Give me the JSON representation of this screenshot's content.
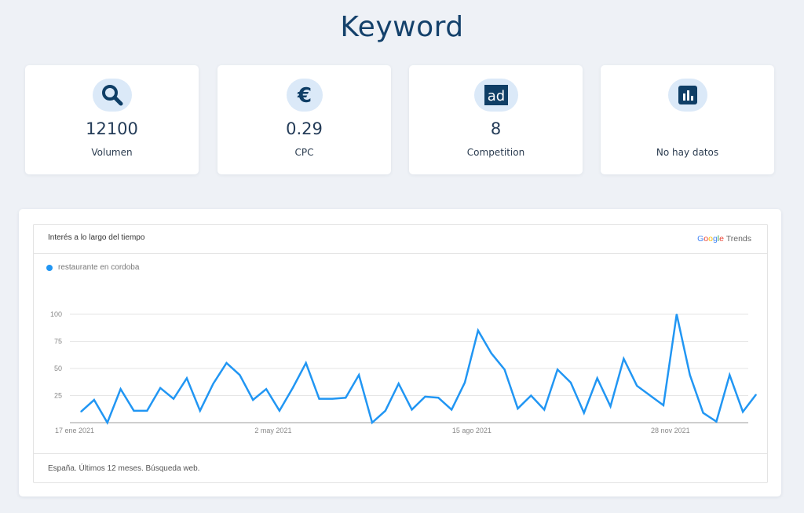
{
  "page": {
    "title": "Keyword"
  },
  "cards": [
    {
      "icon": "search-icon",
      "value": "12100",
      "label": "Volumen"
    },
    {
      "icon": "euro-icon",
      "value": "0.29",
      "label": "CPC"
    },
    {
      "icon": "ad-icon",
      "value": "8",
      "label": "Competition"
    },
    {
      "icon": "bar-chart-icon",
      "value": "",
      "label": "No hay datos"
    }
  ],
  "colors": {
    "accent": "#14416b",
    "icon_bg": "#dbe9f8",
    "line": "#2196f3"
  },
  "trends": {
    "title": "Interés a lo largo del tiempo",
    "logo_google": "Google",
    "logo_trends": "Trends",
    "legend": "restaurante en cordoba",
    "footer": "España. Últimos 12 meses. Búsqueda web."
  },
  "chart_data": {
    "type": "line",
    "ylim": [
      0,
      100
    ],
    "yticks": [
      25,
      50,
      75,
      100
    ],
    "grid": true,
    "x_tick_labels": [
      "17 ene 2021",
      "2 may 2021",
      "15 ago 2021",
      "28 nov 2021"
    ],
    "x_tick_indices": [
      0,
      15,
      30,
      45
    ],
    "series": [
      {
        "name": "restaurante en cordoba",
        "values": [
          10,
          21,
          0,
          31,
          11,
          11,
          32,
          22,
          41,
          11,
          36,
          55,
          44,
          21,
          31,
          11,
          32,
          55,
          22,
          22,
          23,
          44,
          0,
          11,
          36,
          12,
          24,
          23,
          12,
          37,
          85,
          64,
          49,
          13,
          25,
          12,
          49,
          37,
          9,
          41,
          15,
          59,
          34,
          25,
          16,
          100,
          44,
          9,
          1,
          44,
          10,
          26
        ]
      }
    ]
  }
}
